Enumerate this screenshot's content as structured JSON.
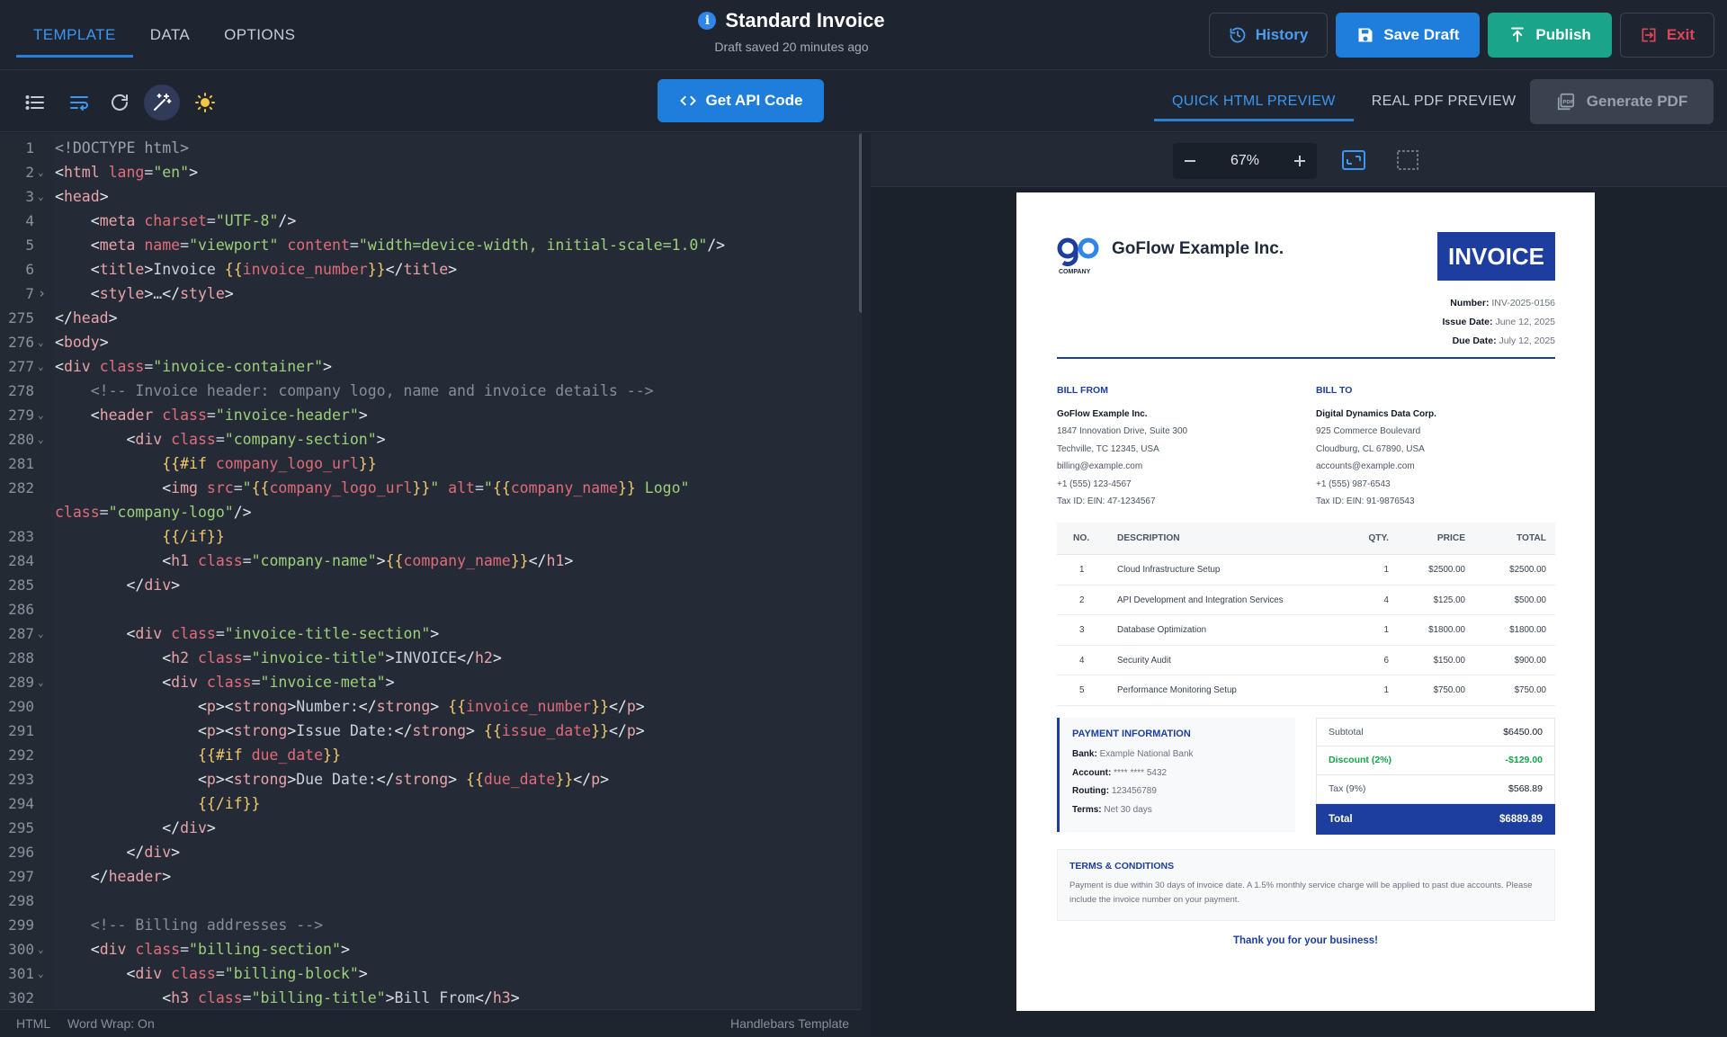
{
  "header": {
    "tabs": [
      "TEMPLATE",
      "DATA",
      "OPTIONS"
    ],
    "title": "Standard Invoice",
    "draft_status": "Draft saved 20 minutes ago",
    "buttons": {
      "history": "History",
      "save": "Save Draft",
      "publish": "Publish",
      "exit": "Exit"
    }
  },
  "toolbar": {
    "api_button": "Get API Code",
    "preview_tabs": [
      "QUICK HTML PREVIEW",
      "REAL PDF PREVIEW"
    ],
    "generate_button": "Generate PDF"
  },
  "zoom": {
    "value": "67%"
  },
  "editor": {
    "status_mode": "HTML",
    "status_wrap": "Word Wrap: On",
    "status_lang": "Handlebars Template",
    "lines": [
      {
        "n": "1",
        "fold": "",
        "code": "<span class=\"dt\">&lt;!DOCTYPE html&gt;</span>"
      },
      {
        "n": "2",
        "fold": "v",
        "code": "<span class=\"t\">&lt;</span><span class=\"tn\">html</span> <span class=\"at\">lang</span>=<span class=\"s\">\"en\"</span><span class=\"t\">&gt;</span>"
      },
      {
        "n": "3",
        "fold": "v",
        "code": "<span class=\"t\">&lt;</span><span class=\"tn\">head</span><span class=\"t\">&gt;</span>"
      },
      {
        "n": "4",
        "fold": "",
        "code": "    <span class=\"t\">&lt;</span><span class=\"tn\">meta</span> <span class=\"at\">charset</span>=<span class=\"s\">\"UTF-8\"</span><span class=\"t\">/&gt;</span>"
      },
      {
        "n": "5",
        "fold": "",
        "code": "    <span class=\"t\">&lt;</span><span class=\"tn\">meta</span> <span class=\"at\">name</span>=<span class=\"s\">\"viewport\"</span> <span class=\"at\">content</span>=<span class=\"s\">\"width=device-width, initial-scale=1.0\"</span><span class=\"t\">/&gt;</span>"
      },
      {
        "n": "6",
        "fold": "",
        "code": "    <span class=\"t\">&lt;</span><span class=\"tn\">title</span><span class=\"t\">&gt;</span>Invoice <span class=\"hb\">{{</span><span class=\"hv\">invoice_number</span><span class=\"hb\">}}</span><span class=\"t\">&lt;/</span><span class=\"tn\">title</span><span class=\"t\">&gt;</span>"
      },
      {
        "n": "7",
        "fold": ">",
        "code": "    <span class=\"t\">&lt;</span><span class=\"tn\">style</span><span class=\"t\">&gt;</span>…<span class=\"t\">&lt;/</span><span class=\"tn\">style</span><span class=\"t\">&gt;</span>"
      },
      {
        "n": "275",
        "fold": "",
        "code": "<span class=\"t\">&lt;/</span><span class=\"tn\">head</span><span class=\"t\">&gt;</span>"
      },
      {
        "n": "276",
        "fold": "v",
        "code": "<span class=\"t\">&lt;</span><span class=\"tn\">body</span><span class=\"t\">&gt;</span>"
      },
      {
        "n": "277",
        "fold": "v",
        "code": "<span class=\"t\">&lt;</span><span class=\"tn\">div</span> <span class=\"at\">class</span>=<span class=\"s\">\"invoice-container\"</span><span class=\"t\">&gt;</span>"
      },
      {
        "n": "278",
        "fold": "",
        "code": "    <span class=\"c\">&lt;!-- Invoice header: company logo, name and invoice details --&gt;</span>"
      },
      {
        "n": "279",
        "fold": "v",
        "code": "    <span class=\"t\">&lt;</span><span class=\"tn\">header</span> <span class=\"at\">class</span>=<span class=\"s\">\"invoice-header\"</span><span class=\"t\">&gt;</span>"
      },
      {
        "n": "280",
        "fold": "v",
        "code": "        <span class=\"t\">&lt;</span><span class=\"tn\">div</span> <span class=\"at\">class</span>=<span class=\"s\">\"company-section\"</span><span class=\"t\">&gt;</span>"
      },
      {
        "n": "281",
        "fold": "",
        "code": "            <span class=\"hb\">{{#if</span> <span class=\"hv\">company_logo_url</span><span class=\"hb\">}}</span>"
      },
      {
        "n": "282",
        "fold": "",
        "code": "            <span class=\"t\">&lt;</span><span class=\"tn\">img</span> <span class=\"at\">src</span>=<span class=\"s\">\"</span><span class=\"hb\">{{</span><span class=\"hv\">company_logo_url</span><span class=\"hb\">}}</span><span class=\"s\">\"</span> <span class=\"at\">alt</span>=<span class=\"s\">\"</span><span class=\"hb\">{{</span><span class=\"hv\">company_name</span><span class=\"hb\">}}</span><span class=\"s\"> Logo\"</span>"
      },
      {
        "n": "",
        "fold": "",
        "code": "<span class=\"at\">class</span>=<span class=\"s\">\"company-logo\"</span><span class=\"t\">/&gt;</span>"
      },
      {
        "n": "283",
        "fold": "",
        "code": "            <span class=\"hb\">{{/if}}</span>"
      },
      {
        "n": "284",
        "fold": "",
        "code": "            <span class=\"t\">&lt;</span><span class=\"tn\">h1</span> <span class=\"at\">class</span>=<span class=\"s\">\"company-name\"</span><span class=\"t\">&gt;</span><span class=\"hb\">{{</span><span class=\"hv\">company_name</span><span class=\"hb\">}}</span><span class=\"t\">&lt;/</span><span class=\"tn\">h1</span><span class=\"t\">&gt;</span>"
      },
      {
        "n": "285",
        "fold": "",
        "code": "        <span class=\"t\">&lt;/</span><span class=\"tn\">div</span><span class=\"t\">&gt;</span>"
      },
      {
        "n": "286",
        "fold": "",
        "code": ""
      },
      {
        "n": "287",
        "fold": "v",
        "code": "        <span class=\"t\">&lt;</span><span class=\"tn\">div</span> <span class=\"at\">class</span>=<span class=\"s\">\"invoice-title-section\"</span><span class=\"t\">&gt;</span>"
      },
      {
        "n": "288",
        "fold": "",
        "code": "            <span class=\"t\">&lt;</span><span class=\"tn\">h2</span> <span class=\"at\">class</span>=<span class=\"s\">\"invoice-title\"</span><span class=\"t\">&gt;</span>INVOICE<span class=\"t\">&lt;/</span><span class=\"tn\">h2</span><span class=\"t\">&gt;</span>"
      },
      {
        "n": "289",
        "fold": "v",
        "code": "            <span class=\"t\">&lt;</span><span class=\"tn\">div</span> <span class=\"at\">class</span>=<span class=\"s\">\"invoice-meta\"</span><span class=\"t\">&gt;</span>"
      },
      {
        "n": "290",
        "fold": "",
        "code": "                <span class=\"t\">&lt;</span><span class=\"tn\">p</span><span class=\"t\">&gt;&lt;</span><span class=\"tn\">strong</span><span class=\"t\">&gt;</span>Number:<span class=\"t\">&lt;/</span><span class=\"tn\">strong</span><span class=\"t\">&gt;</span> <span class=\"hb\">{{</span><span class=\"hv\">invoice_number</span><span class=\"hb\">}}</span><span class=\"t\">&lt;/</span><span class=\"tn\">p</span><span class=\"t\">&gt;</span>"
      },
      {
        "n": "291",
        "fold": "",
        "code": "                <span class=\"t\">&lt;</span><span class=\"tn\">p</span><span class=\"t\">&gt;&lt;</span><span class=\"tn\">strong</span><span class=\"t\">&gt;</span>Issue Date:<span class=\"t\">&lt;/</span><span class=\"tn\">strong</span><span class=\"t\">&gt;</span> <span class=\"hb\">{{</span><span class=\"hv\">issue_date</span><span class=\"hb\">}}</span><span class=\"t\">&lt;/</span><span class=\"tn\">p</span><span class=\"t\">&gt;</span>"
      },
      {
        "n": "292",
        "fold": "",
        "code": "                <span class=\"hb\">{{#if</span> <span class=\"hv\">due_date</span><span class=\"hb\">}}</span>"
      },
      {
        "n": "293",
        "fold": "",
        "code": "                <span class=\"t\">&lt;</span><span class=\"tn\">p</span><span class=\"t\">&gt;&lt;</span><span class=\"tn\">strong</span><span class=\"t\">&gt;</span>Due Date:<span class=\"t\">&lt;/</span><span class=\"tn\">strong</span><span class=\"t\">&gt;</span> <span class=\"hb\">{{</span><span class=\"hv\">due_date</span><span class=\"hb\">}}</span><span class=\"t\">&lt;/</span><span class=\"tn\">p</span><span class=\"t\">&gt;</span>"
      },
      {
        "n": "294",
        "fold": "",
        "code": "                <span class=\"hb\">{{/if}}</span>"
      },
      {
        "n": "295",
        "fold": "",
        "code": "            <span class=\"t\">&lt;/</span><span class=\"tn\">div</span><span class=\"t\">&gt;</span>"
      },
      {
        "n": "296",
        "fold": "",
        "code": "        <span class=\"t\">&lt;/</span><span class=\"tn\">div</span><span class=\"t\">&gt;</span>"
      },
      {
        "n": "297",
        "fold": "",
        "code": "    <span class=\"t\">&lt;/</span><span class=\"tn\">header</span><span class=\"t\">&gt;</span>"
      },
      {
        "n": "298",
        "fold": "",
        "code": ""
      },
      {
        "n": "299",
        "fold": "",
        "code": "    <span class=\"c\">&lt;!-- Billing addresses --&gt;</span>"
      },
      {
        "n": "300",
        "fold": "v",
        "code": "    <span class=\"t\">&lt;</span><span class=\"tn\">div</span> <span class=\"at\">class</span>=<span class=\"s\">\"billing-section\"</span><span class=\"t\">&gt;</span>"
      },
      {
        "n": "301",
        "fold": "v",
        "code": "        <span class=\"t\">&lt;</span><span class=\"tn\">div</span> <span class=\"at\">class</span>=<span class=\"s\">\"billing-block\"</span><span class=\"t\">&gt;</span>"
      },
      {
        "n": "302",
        "fold": "",
        "code": "            <span class=\"t\">&lt;</span><span class=\"tn\">h3</span> <span class=\"at\">class</span>=<span class=\"s\">\"billing-title\"</span><span class=\"t\">&gt;</span>Bill From<span class=\"t\">&lt;/</span><span class=\"tn\">h3</span><span class=\"t\">&gt;</span>"
      }
    ]
  },
  "invoice": {
    "logo_text": "COMPANY",
    "company_name": "GoFlow Example Inc.",
    "badge": "INVOICE",
    "meta": [
      {
        "label": "Number:",
        "value": "INV-2025-0156"
      },
      {
        "label": "Issue Date:",
        "value": "June 12, 2025"
      },
      {
        "label": "Due Date:",
        "value": "July 12, 2025"
      }
    ],
    "bill_from": {
      "heading": "BILL FROM",
      "name": "GoFlow Example Inc.",
      "lines": [
        "1847 Innovation Drive, Suite 300",
        "Techville, TC 12345, USA",
        "billing@example.com",
        "+1 (555) 123-4567",
        "Tax ID: EIN: 47-1234567"
      ]
    },
    "bill_to": {
      "heading": "BILL TO",
      "name": "Digital Dynamics Data Corp.",
      "lines": [
        "925 Commerce Boulevard",
        "Cloudburg, CL 67890, USA",
        "accounts@example.com",
        "+1 (555) 987-6543",
        "Tax ID: EIN: 91-9876543"
      ]
    },
    "table": {
      "headers": [
        "NO.",
        "DESCRIPTION",
        "QTY.",
        "PRICE",
        "TOTAL"
      ],
      "rows": [
        [
          "1",
          "Cloud Infrastructure Setup",
          "1",
          "$2500.00",
          "$2500.00"
        ],
        [
          "2",
          "API Development and Integration Services",
          "4",
          "$125.00",
          "$500.00"
        ],
        [
          "3",
          "Database Optimization",
          "1",
          "$1800.00",
          "$1800.00"
        ],
        [
          "4",
          "Security Audit",
          "6",
          "$150.00",
          "$900.00"
        ],
        [
          "5",
          "Performance Monitoring Setup",
          "1",
          "$750.00",
          "$750.00"
        ]
      ]
    },
    "payment": {
      "heading": "PAYMENT INFORMATION",
      "items": [
        {
          "label": "Bank:",
          "value": "Example National Bank"
        },
        {
          "label": "Account:",
          "value": "**** **** 5432"
        },
        {
          "label": "Routing:",
          "value": "123456789"
        },
        {
          "label": "Terms:",
          "value": "Net 30 days"
        }
      ]
    },
    "totals": [
      {
        "label": "Subtotal",
        "value": "$6450.00"
      },
      {
        "label": "Discount (2%)",
        "value": "-$129.00"
      },
      {
        "label": "Tax (9%)",
        "value": "$568.89"
      },
      {
        "label": "Total",
        "value": "$6889.89"
      }
    ],
    "terms": {
      "heading": "TERMS & CONDITIONS",
      "text": "Payment is due within 30 days of invoice date. A 1.5% monthly service charge will be applied to past due accounts. Please include the invoice number on your payment."
    },
    "thanks": "Thank you for your business!"
  },
  "colors": {
    "accent": "#1f7ddb",
    "publish": "#1aa58a",
    "exit": "#e0445a",
    "invoice_blue": "#1d3e9e",
    "discount": "#16a34a"
  },
  "icons": [
    "history-icon",
    "save-icon",
    "publish-icon",
    "exit-icon",
    "list-icon",
    "wrap-icon",
    "refresh-icon",
    "magic-wand-icon",
    "sun-icon",
    "code-icon",
    "pdf-icon",
    "minus-icon",
    "plus-icon",
    "fit-width-icon",
    "fit-page-icon",
    "info-icon"
  ]
}
